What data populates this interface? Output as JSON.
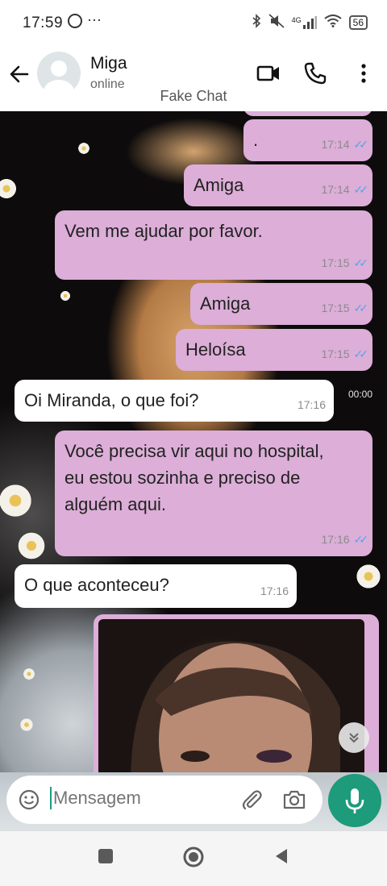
{
  "status_bar": {
    "time": "17:59",
    "more": "···",
    "network": "4G",
    "battery": "56"
  },
  "header": {
    "name": "Miga",
    "status": "online",
    "overlay": "Fake Chat"
  },
  "messages": [
    {
      "dir": "out",
      "text": ".",
      "time": "17:14"
    },
    {
      "dir": "out",
      "text": "Amiga",
      "time": "17:14"
    },
    {
      "dir": "out",
      "text": "Vem me ajudar por favor.",
      "time": "17:15"
    },
    {
      "dir": "out",
      "text": "Amiga",
      "time": "17:15"
    },
    {
      "dir": "out",
      "text": "Heloísa",
      "time": "17:15"
    },
    {
      "dir": "in",
      "text": "Oi Miranda, o que foi?",
      "time": "17:16"
    },
    {
      "dir": "out",
      "text": "Você precisa vir aqui no hospital, eu estou sozinha e preciso de alguém aqui.",
      "time": "17:16"
    },
    {
      "dir": "in",
      "text": "O que aconteceu?",
      "time": "17:16"
    }
  ],
  "floating_time": "00:00",
  "composer": {
    "placeholder": "Mensagem"
  },
  "colors": {
    "outgoing": "#dcaed8",
    "incoming": "#ffffff",
    "accent": "#1d9b7b",
    "ticks": "#4fa7e8"
  }
}
